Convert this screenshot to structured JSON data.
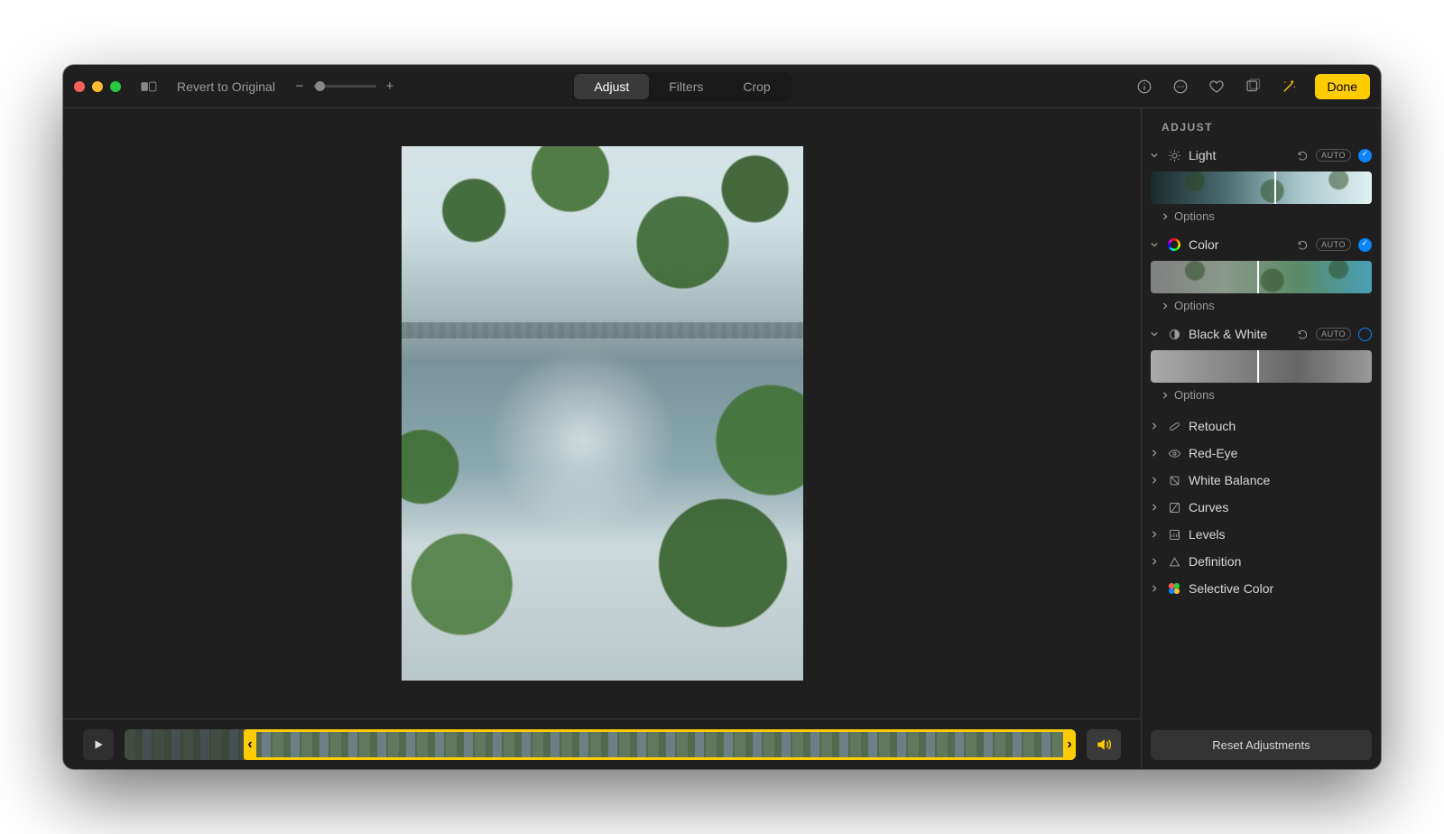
{
  "toolbar": {
    "revert_label": "Revert to Original",
    "tabs": {
      "adjust": "Adjust",
      "filters": "Filters",
      "crop": "Crop"
    },
    "done_label": "Done"
  },
  "sidebar": {
    "heading": "ADJUST",
    "light": {
      "title": "Light",
      "options": "Options",
      "auto": "AUTO"
    },
    "color": {
      "title": "Color",
      "options": "Options",
      "auto": "AUTO"
    },
    "bw": {
      "title": "Black & White",
      "options": "Options",
      "auto": "AUTO"
    },
    "retouch": {
      "title": "Retouch"
    },
    "redeye": {
      "title": "Red-Eye"
    },
    "wb": {
      "title": "White Balance"
    },
    "curves": {
      "title": "Curves"
    },
    "levels": {
      "title": "Levels"
    },
    "definition": {
      "title": "Definition"
    },
    "selcolor": {
      "title": "Selective Color"
    },
    "reset_label": "Reset Adjustments"
  }
}
